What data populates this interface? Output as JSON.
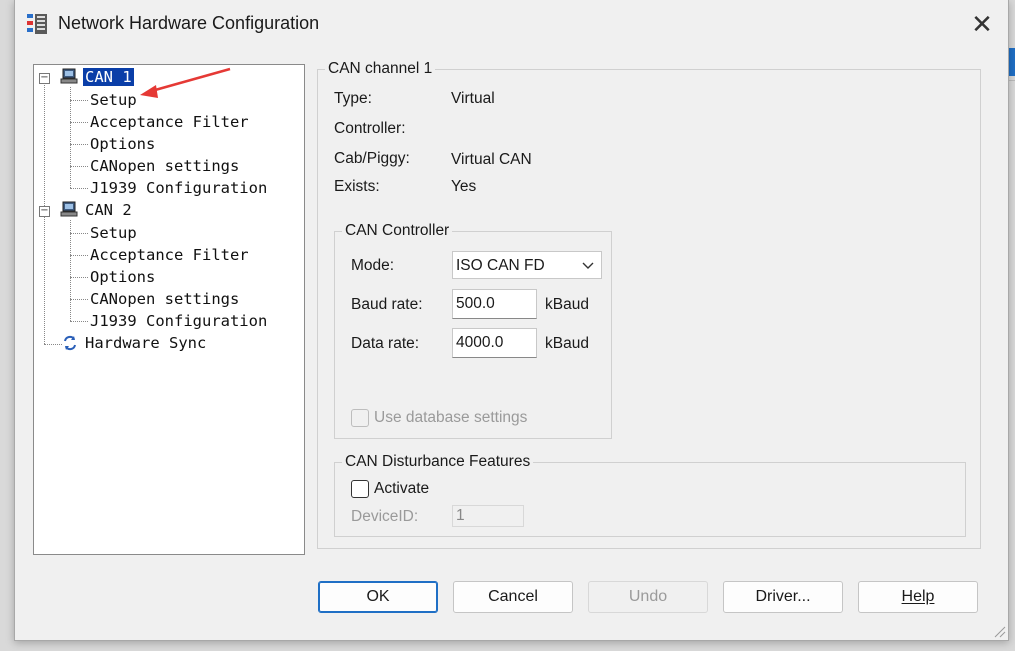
{
  "window": {
    "title": "Network Hardware Configuration",
    "close_glyph": "✕"
  },
  "tree": {
    "channels": [
      {
        "label": "CAN 1",
        "expander": "−",
        "children": [
          "Setup",
          "Acceptance Filter",
          "Options",
          "CANopen settings",
          "J1939 Configuration"
        ]
      },
      {
        "label": "CAN 2",
        "expander": "−",
        "children": [
          "Setup",
          "Acceptance Filter",
          "Options",
          "CANopen settings",
          "J1939 Configuration"
        ]
      }
    ],
    "sync_label": "Hardware Sync",
    "selected": "CAN 1"
  },
  "channel": {
    "group_title": "CAN channel 1",
    "type_label": "Type:",
    "type_value": "Virtual",
    "controller_label": "Controller:",
    "controller_value": "",
    "cab_label": "Cab/Piggy:",
    "cab_value": "Virtual CAN",
    "exists_label": "Exists:",
    "exists_value": "Yes"
  },
  "controller": {
    "group_title": "CAN Controller",
    "mode_label": "Mode:",
    "mode_value": "ISO CAN FD",
    "baud_label": "Baud rate:",
    "baud_value": "500.0",
    "baud_unit": "kBaud",
    "data_label": "Data rate:",
    "data_value": "4000.0",
    "data_unit": "kBaud",
    "use_db_label": "Use database settings"
  },
  "disturbance": {
    "group_title": "CAN Disturbance Features",
    "activate_label": "Activate",
    "device_label": "DeviceID:",
    "device_value": "1"
  },
  "buttons": {
    "ok": "OK",
    "cancel": "Cancel",
    "undo": "Undo",
    "driver": "Driver...",
    "help": "Help"
  },
  "colors": {
    "selection": "#0a3ea8",
    "accent": "#1f6fc5",
    "annotation_arrow": "#e53935"
  },
  "icons": {
    "app": "network-config-icon",
    "channel": "computer-icon",
    "sync": "sync-icon",
    "close": "close-icon"
  }
}
